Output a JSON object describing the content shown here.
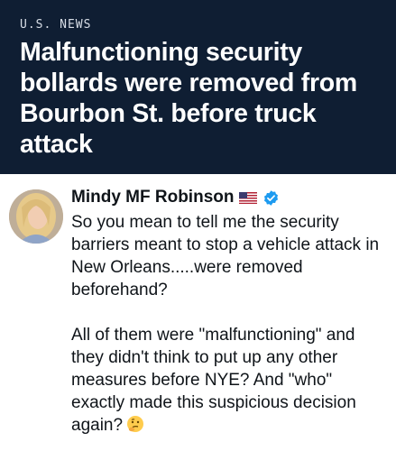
{
  "header": {
    "section": "U.S. NEWS",
    "headline": "Malfunctioning security bollards were removed from Bourbon St. before truck attack",
    "background_color": "#0f1e33"
  },
  "tweet": {
    "author": "Mindy MF Robinson",
    "flag_icon": "us-flag-icon",
    "verified_icon": "verified-badge-icon",
    "paragraph_1": "So you mean to tell me the security barriers meant to stop a vehicle attack in New Orleans.....were removed beforehand?",
    "paragraph_2": "All of them were \"malfunctioning\" and they didn't think to put up any other measures before NYE? And \"who\" exactly made this suspicious decision again?",
    "end_emoji": "thinking-face-emoji",
    "verified_color": "#1d9bf0"
  }
}
